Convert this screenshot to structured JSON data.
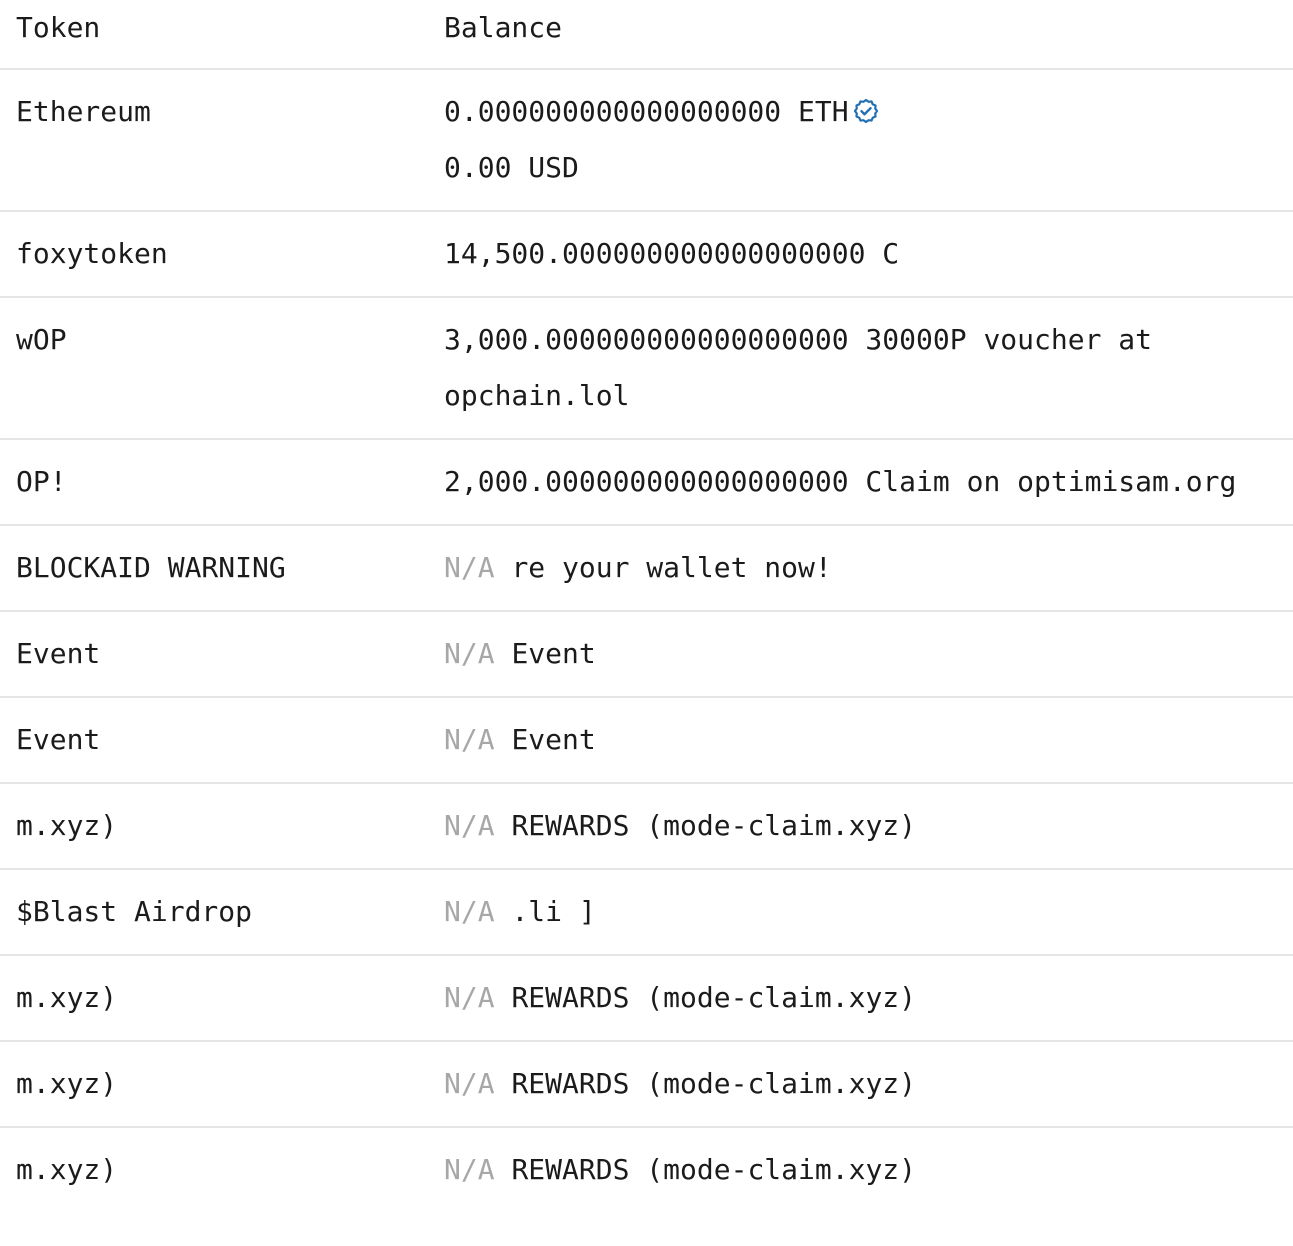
{
  "header": {
    "token_label": "Token",
    "balance_label": "Balance"
  },
  "rows": [
    {
      "token": "Ethereum",
      "balance": "0.000000000000000000 ETH",
      "usd": "0.00 USD",
      "verified": true
    },
    {
      "token": "foxytoken",
      "balance": "14,500.000000000000000000 C"
    },
    {
      "token": "wOP",
      "balance": "3,000.000000000000000000 30000P voucher at opchain.lol"
    },
    {
      "token": "OP!",
      "balance": "2,000.000000000000000000 Claim on optimisam.org"
    },
    {
      "token": "BLOCKAID WARNING",
      "na": "N/A",
      "balance": "re your wallet now!"
    },
    {
      "token": "Event",
      "na": "N/A",
      "balance": "Event"
    },
    {
      "token": "Event",
      "na": "N/A",
      "balance": "Event"
    },
    {
      "token": "m.xyz)",
      "na": "N/A",
      "balance": "REWARDS (mode-claim.xyz)"
    },
    {
      "token": "$Blast Airdrop",
      "na": "N/A",
      "balance": ".li ]"
    },
    {
      "token": "m.xyz)",
      "na": "N/A",
      "balance": "REWARDS (mode-claim.xyz)"
    },
    {
      "token": "m.xyz)",
      "na": "N/A",
      "balance": "REWARDS (mode-claim.xyz)"
    },
    {
      "token": "m.xyz)",
      "na": "N/A",
      "balance": "REWARDS (mode-claim.xyz)"
    }
  ],
  "colors": {
    "text": "#1b1b1b",
    "muted": "#a7a7a7",
    "divider": "#e6e6e6",
    "verified_icon": "#1f6fb3"
  },
  "icons": {
    "verified": "verified-badge-icon"
  }
}
